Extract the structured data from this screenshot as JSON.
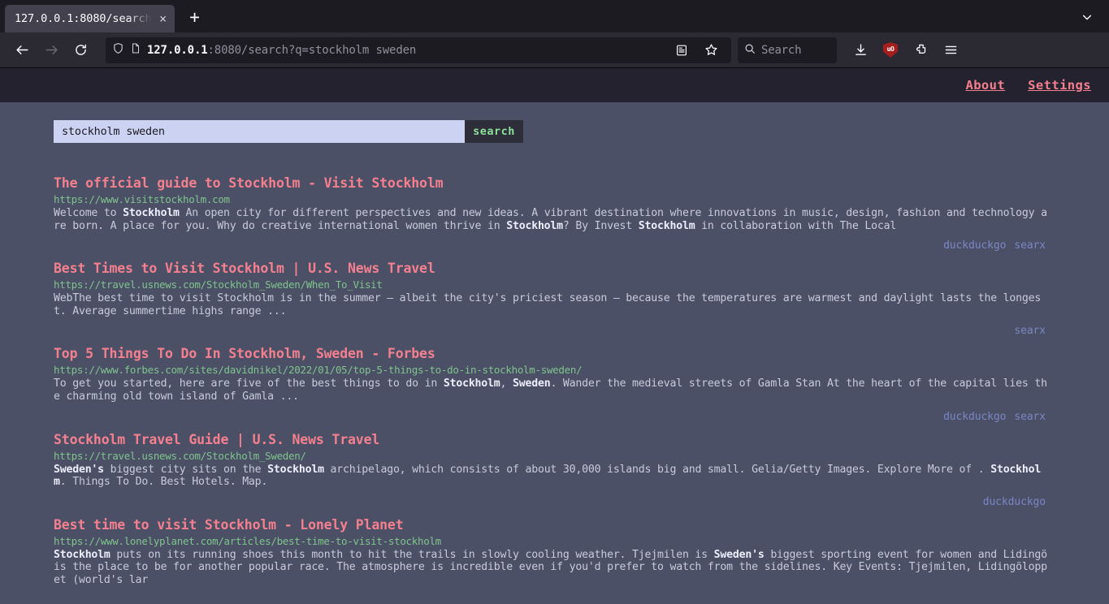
{
  "browser": {
    "tab": {
      "title": "127.0.0.1:8080/search",
      "close_label": "×"
    },
    "new_tab_label": "+",
    "list_all_tabs_label": "list all tabs",
    "back_label": "Back",
    "forward_label": "Forward",
    "reload_label": "Reload",
    "url": {
      "host": "127.0.0.1",
      "rest": ":8080/search?q=stockholm sweden",
      "full": "127.0.0.1:8080/search?q=stockholm sweden"
    },
    "search": {
      "placeholder": "Search",
      "value": ""
    },
    "extensions": {
      "ublock_label": "uO"
    }
  },
  "site": {
    "nav": [
      {
        "label": "About"
      },
      {
        "label": "Settings"
      }
    ],
    "search": {
      "query": "stockholm sweden",
      "placeholder": "",
      "submit_label": "search"
    }
  },
  "results": [
    {
      "title": "The official guide to Stockholm - Visit Stockholm",
      "url": "https://www.visitstockholm.com",
      "content_html": "Welcome to <b>Stockholm</b> An open city for different perspectives and new ideas. A vibrant destination where innovations in music, design, fashion and technology are born. A place for you. Why do creative international women thrive in <b>Stockholm</b>? By Invest <b>Stockholm</b> in collaboration with The Local",
      "engines": [
        "duckduckgo",
        "searx"
      ]
    },
    {
      "title": "Best Times to Visit Stockholm | U.S. News Travel",
      "url": "https://travel.usnews.com/Stockholm_Sweden/When_To_Visit",
      "content_html": "WebThe best time to visit Stockholm is in the summer – albeit the city's priciest season – because the temperatures are warmest and daylight lasts the longest. Average summertime highs range ...",
      "engines": [
        "searx"
      ]
    },
    {
      "title": "Top 5 Things To Do In Stockholm, Sweden - Forbes",
      "url": "https://www.forbes.com/sites/davidnikel/2022/01/05/top-5-things-to-do-in-stockholm-sweden/",
      "content_html": "To get you started, here are five of the best things to do in <b>Stockholm</b>, <b>Sweden</b>. Wander the medieval streets of Gamla Stan At the heart of the capital lies the charming old town island of Gamla ...",
      "engines": [
        "duckduckgo",
        "searx"
      ]
    },
    {
      "title": "Stockholm Travel Guide | U.S. News Travel",
      "url": "https://travel.usnews.com/Stockholm_Sweden/",
      "content_html": "<b>Sweden's</b> biggest city sits on the <b>Stockholm</b> archipelago, which consists of about 30,000 islands big and small. Gelia/Getty Images. Explore More of . <b>Stockholm</b>. Things To Do. Best Hotels. Map.",
      "engines": [
        "duckduckgo"
      ]
    },
    {
      "title": "Best time to visit Stockholm - Lonely Planet",
      "url": "https://www.lonelyplanet.com/articles/best-time-to-visit-stockholm",
      "content_html": "<b>Stockholm</b> puts on its running shoes this month to hit the trails in slowly cooling weather. Tjejmilen is <b>Sweden's</b> biggest sporting event for women and Lidingö is the place to be for another popular race. The atmosphere is incredible even if you'd prefer to watch from the sidelines. Key Events: Tjejmilen, Lidingöloppet (world's lar",
      "engines": []
    }
  ]
}
